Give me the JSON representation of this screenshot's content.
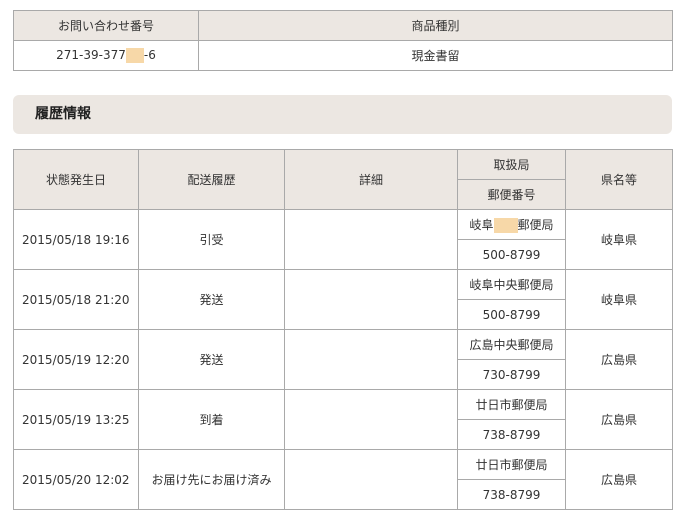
{
  "summary": {
    "headers": {
      "inquiry_number": "お問い合わせ番号",
      "item_type": "商品種別"
    },
    "inquiry_number_prefix": "271-39-377",
    "inquiry_number_suffix": "-6",
    "item_type": "現金書留"
  },
  "history": {
    "title": "履歴情報",
    "headers": {
      "date": "状態発生日",
      "status": "配送履歴",
      "detail": "詳細",
      "office": "取扱局",
      "postal_code": "郵便番号",
      "prefecture": "県名等"
    },
    "rows": [
      {
        "date": "2015/05/18 19:16",
        "status": "引受",
        "detail": "",
        "office_prefix": "岐阜",
        "office_suffix": "郵便局",
        "postal_code": "500-8799",
        "prefecture": "岐阜県"
      },
      {
        "date": "2015/05/18 21:20",
        "status": "発送",
        "detail": "",
        "office": "岐阜中央郵便局",
        "postal_code": "500-8799",
        "prefecture": "岐阜県"
      },
      {
        "date": "2015/05/19 12:20",
        "status": "発送",
        "detail": "",
        "office": "広島中央郵便局",
        "postal_code": "730-8799",
        "prefecture": "広島県"
      },
      {
        "date": "2015/05/19 13:25",
        "status": "到着",
        "detail": "",
        "office": "廿日市郵便局",
        "postal_code": "738-8799",
        "prefecture": "広島県"
      },
      {
        "date": "2015/05/20 12:02",
        "status": "お届け先にお届け済み",
        "detail": "",
        "office": "廿日市郵便局",
        "postal_code": "738-8799",
        "prefecture": "広島県"
      }
    ]
  }
}
